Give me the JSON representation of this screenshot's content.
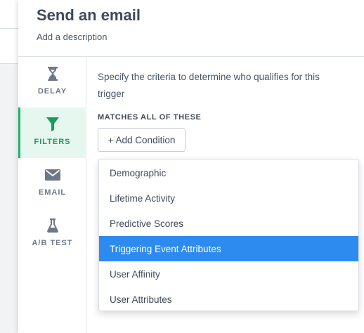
{
  "panel": {
    "title": "Send an email",
    "description": "Add a description"
  },
  "tabs": [
    {
      "label": "DELAY",
      "icon": "hourglass-icon",
      "active": false
    },
    {
      "label": "FILTERS",
      "icon": "filter-icon",
      "active": true
    },
    {
      "label": "EMAIL",
      "icon": "envelope-icon",
      "active": false
    },
    {
      "label": "A/B TEST",
      "icon": "flask-icon",
      "active": false
    }
  ],
  "filters": {
    "criteria_text": "Specify the criteria to determine who qualifies for this trigger",
    "matches_label": "MATCHES ALL OF THESE",
    "add_condition_label": "+ Add Condition"
  },
  "dropdown": {
    "items": [
      "Demographic",
      "Lifetime Activity",
      "Predictive Scores",
      "Triggering Event Attributes",
      "User Affinity",
      "User Attributes"
    ],
    "selected": "Triggering Event Attributes"
  },
  "colors": {
    "active_tab": "#1fb36b",
    "selected_item": "#2d8bf0"
  }
}
